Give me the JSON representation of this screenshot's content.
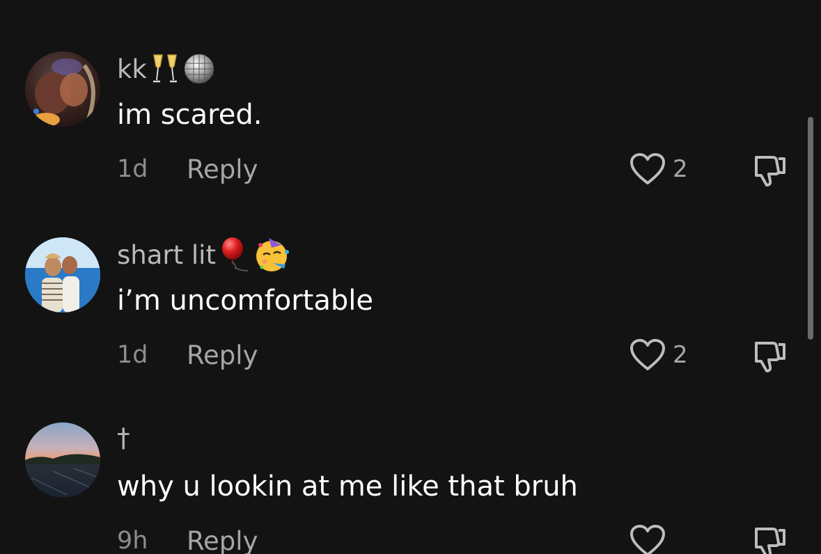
{
  "colors": {
    "background": "#131313",
    "username": "#b9b9b9",
    "comment_text": "#ffffff",
    "meta": "#a6a6a6"
  },
  "comments": [
    {
      "username": "kk",
      "username_emojis": [
        "champagne-glasses",
        "disco-ball"
      ],
      "text": "im scared.",
      "timestamp": "1d",
      "reply_label": "Reply",
      "like_count": "2",
      "avatar": "profile-photo-indoor-dark"
    },
    {
      "username": "shart lit",
      "username_emojis": [
        "red-balloon",
        "partying-face"
      ],
      "text": "i’m uncomfortable",
      "timestamp": "1d",
      "reply_label": "Reply",
      "like_count": "2",
      "avatar": "profile-photo-two-people-by-sea"
    },
    {
      "username": "†",
      "username_emojis": [],
      "text": "why u lookin at me like that bruh",
      "timestamp": "9h",
      "reply_label": "Reply",
      "like_count": "",
      "avatar": "profile-photo-sunset-parking-lot"
    }
  ]
}
